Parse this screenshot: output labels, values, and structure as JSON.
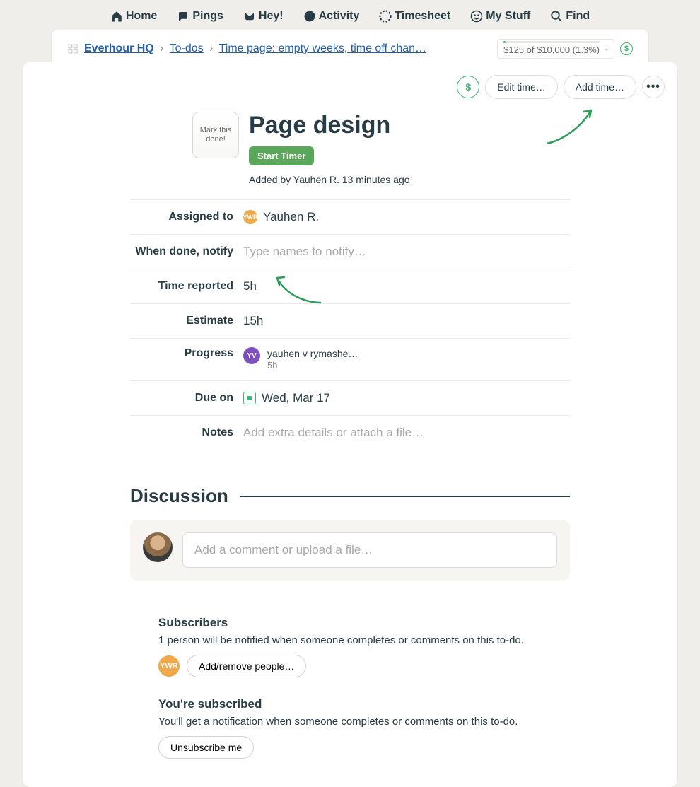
{
  "nav": {
    "home": "Home",
    "pings": "Pings",
    "hey": "Hey!",
    "activity": "Activity",
    "timesheet": "Timesheet",
    "mystuff": "My Stuff",
    "find": "Find"
  },
  "breadcrumb": {
    "root": "Everhour HQ",
    "todos": "To-dos",
    "task": "Time page: empty weeks, time off chan…"
  },
  "budget": {
    "text": "$125 of $10,000 (1.3%)"
  },
  "actions": {
    "edit_time": "Edit time…",
    "add_time": "Add time…"
  },
  "task": {
    "mark_done": "Mark this done!",
    "title": "Page design",
    "start_timer": "Start Timer",
    "added_by": "Added by Yauhen R. 13 minutes ago"
  },
  "fields": {
    "assigned_label": "Assigned to",
    "assigned_value": "Yauhen R.",
    "assigned_initials": "YWR",
    "notify_label": "When done, notify",
    "notify_placeholder": "Type names to notify…",
    "time_reported_label": "Time reported",
    "time_reported_value": "5h",
    "estimate_label": "Estimate",
    "estimate_value": "15h",
    "progress_label": "Progress",
    "progress_initials": "YV",
    "progress_name": "yauhen v rymashe…",
    "progress_time": "5h",
    "due_label": "Due on",
    "due_value": "Wed, Mar 17",
    "notes_label": "Notes",
    "notes_placeholder": "Add extra details or attach a file…"
  },
  "discussion": {
    "title": "Discussion",
    "placeholder": "Add a comment or upload a file…"
  },
  "subscribers": {
    "heading": "Subscribers",
    "text": "1 person will be notified when someone completes or comments on this to-do.",
    "initials": "YWR",
    "button": "Add/remove people…",
    "sub_heading": "You're subscribed",
    "sub_text": "You'll get a notification when someone completes or comments on this to-do.",
    "unsubscribe": "Unsubscribe me"
  }
}
